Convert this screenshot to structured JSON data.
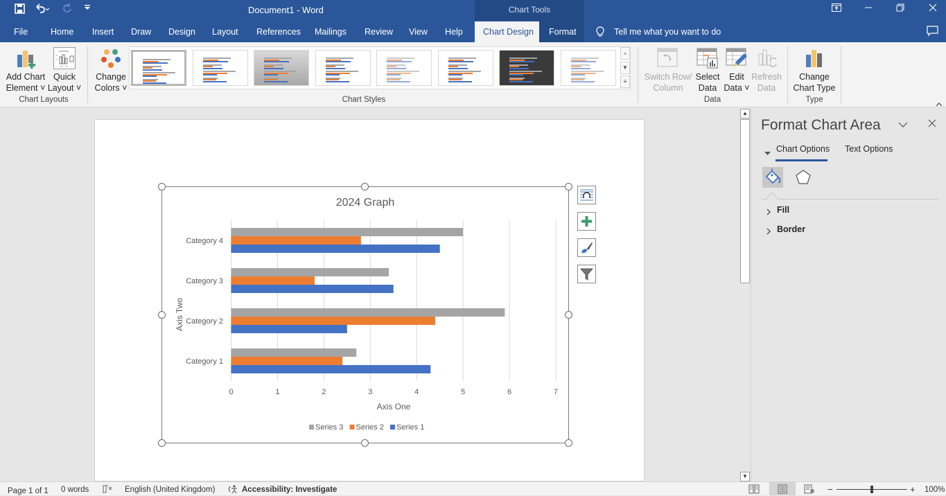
{
  "window": {
    "document_title": "Document1  -  Word",
    "contextual_group": "Chart Tools",
    "controls": [
      "ribbon-display-options",
      "minimize",
      "restore",
      "close"
    ]
  },
  "quick_access": {
    "save_icon": "save-icon",
    "undo_icon": "undo-icon",
    "redo_icon": "redo-icon",
    "customize_icon": "customize-qat-icon"
  },
  "tabs": [
    {
      "label": "File"
    },
    {
      "label": "Home"
    },
    {
      "label": "Insert"
    },
    {
      "label": "Draw"
    },
    {
      "label": "Design"
    },
    {
      "label": "Layout"
    },
    {
      "label": "References"
    },
    {
      "label": "Mailings"
    },
    {
      "label": "Review"
    },
    {
      "label": "View"
    },
    {
      "label": "Help"
    },
    {
      "label": "Chart Design",
      "active": true
    },
    {
      "label": "Format"
    }
  ],
  "tell_me": "Tell me what you want to do",
  "ribbon": {
    "chart_layouts": {
      "group_label": "Chart Layouts",
      "add_chart_element": [
        "Add Chart",
        "Element ˅"
      ],
      "quick_layout": [
        "Quick",
        "Layout ˅"
      ]
    },
    "chart_styles": {
      "group_label": "Chart Styles",
      "change_colors": [
        "Change",
        "Colors ˅"
      ],
      "style_count_visible": 8,
      "selected_style_index": 0
    },
    "data": {
      "group_label": "Data",
      "switch_row_column": [
        "Switch Row/",
        "Column"
      ],
      "select_data": [
        "Select",
        "Data"
      ],
      "edit_data": [
        "Edit",
        "Data ˅"
      ],
      "refresh_data": [
        "Refresh",
        "Data"
      ]
    },
    "type": {
      "group_label": "Type",
      "change_chart_type": [
        "Change",
        "Chart Type"
      ]
    }
  },
  "chart_data": {
    "type": "bar",
    "orientation": "horizontal",
    "title": "2024 Graph",
    "xlabel": "Axis One",
    "ylabel": "Axis Two",
    "categories": [
      "Category 1",
      "Category 2",
      "Category 3",
      "Category 4"
    ],
    "series": [
      {
        "name": "Series 1",
        "color": "#4472c4",
        "values": [
          4.3,
          2.5,
          3.5,
          4.5
        ]
      },
      {
        "name": "Series 2",
        "color": "#ed7d31",
        "values": [
          2.4,
          4.4,
          1.8,
          2.8
        ]
      },
      {
        "name": "Series 3",
        "color": "#a5a5a5",
        "values": [
          2.7,
          5.9,
          3.4,
          5.0
        ]
      }
    ],
    "xlim": [
      0,
      7
    ],
    "xticks": [
      0,
      1,
      2,
      3,
      4,
      5,
      6,
      7
    ],
    "grid": true,
    "legend": [
      "Series 3",
      "Series 2",
      "Series 1"
    ],
    "legend_position": "bottom"
  },
  "chart_side_buttons": [
    "layout-options-icon",
    "chart-elements-plus-icon",
    "chart-styles-brush-icon",
    "chart-filters-icon"
  ],
  "format_pane": {
    "title": "Format Chart Area",
    "tabs": [
      "Chart Options",
      "Text Options"
    ],
    "active_tab": "Chart Options",
    "icons": [
      "fill-line-icon",
      "effects-pentagon-icon"
    ],
    "sections": [
      "Fill",
      "Border"
    ]
  },
  "status_bar": {
    "page": "Page 1 of 1",
    "words": "0 words",
    "language": "English (United Kingdom)",
    "accessibility": "Accessibility: Investigate",
    "zoom": "100%",
    "zoom_minus": "−",
    "zoom_plus": "+"
  }
}
